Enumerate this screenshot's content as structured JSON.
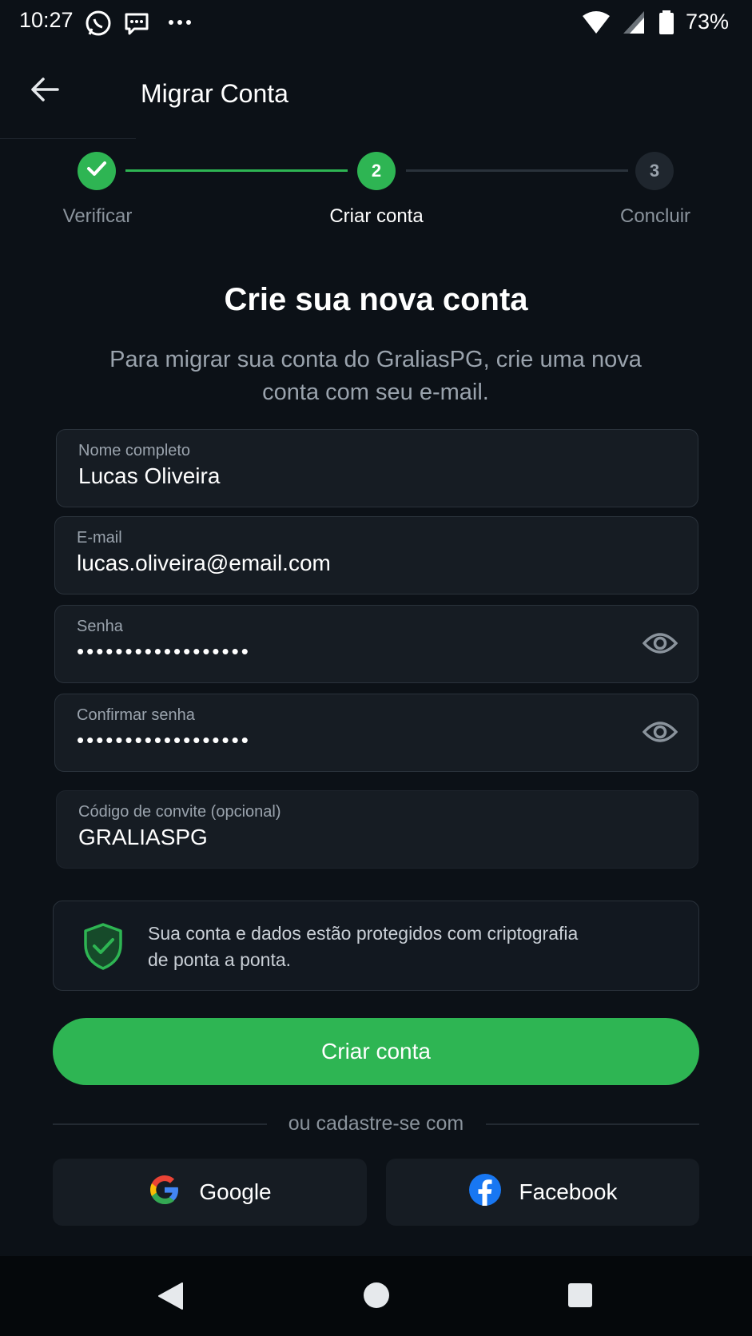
{
  "status_bar": {
    "time": "10:27",
    "battery": "73%",
    "icons": [
      "whatsapp-icon",
      "chat-bubble-icon",
      "more-dots-icon",
      "wifi-icon",
      "signal-icon",
      "battery-icon"
    ]
  },
  "header": {
    "title": "Migrar Conta",
    "back_icon": "arrow-left-icon"
  },
  "stepper": {
    "steps": [
      {
        "number": "",
        "label": "Verificar",
        "state": "done"
      },
      {
        "number": "2",
        "label": "Criar conta",
        "state": "active"
      },
      {
        "number": "3",
        "label": "Concluir",
        "state": "todo"
      }
    ]
  },
  "main": {
    "title": "Crie sua nova conta",
    "subtitle": "Para migrar sua conta do GraliasPG, crie uma nova conta com seu e-mail."
  },
  "form": {
    "name": {
      "label": "Nome completo",
      "value": "Lucas Oliveira"
    },
    "email": {
      "label": "E-mail",
      "value": "lucas.oliveira@email.com"
    },
    "password": {
      "label": "Senha",
      "value": "••••••••••••••••••"
    },
    "confirm_password": {
      "label": "Confirmar senha",
      "value": "••••••••••••••••••"
    },
    "invite_code": {
      "label": "Código de convite (opcional)",
      "value": "GRALIASPG"
    }
  },
  "security_notice": {
    "text": "Sua conta e dados estão protegidos com criptografia de ponta a ponta.",
    "icon": "shield-check-icon"
  },
  "actions": {
    "create_account": "Criar conta",
    "divider_text": "ou cadastre-se com",
    "google": "Google",
    "facebook": "Facebook"
  },
  "colors": {
    "accent": "#2eb553",
    "background": "#0c1117",
    "field_bg": "#161c23"
  }
}
